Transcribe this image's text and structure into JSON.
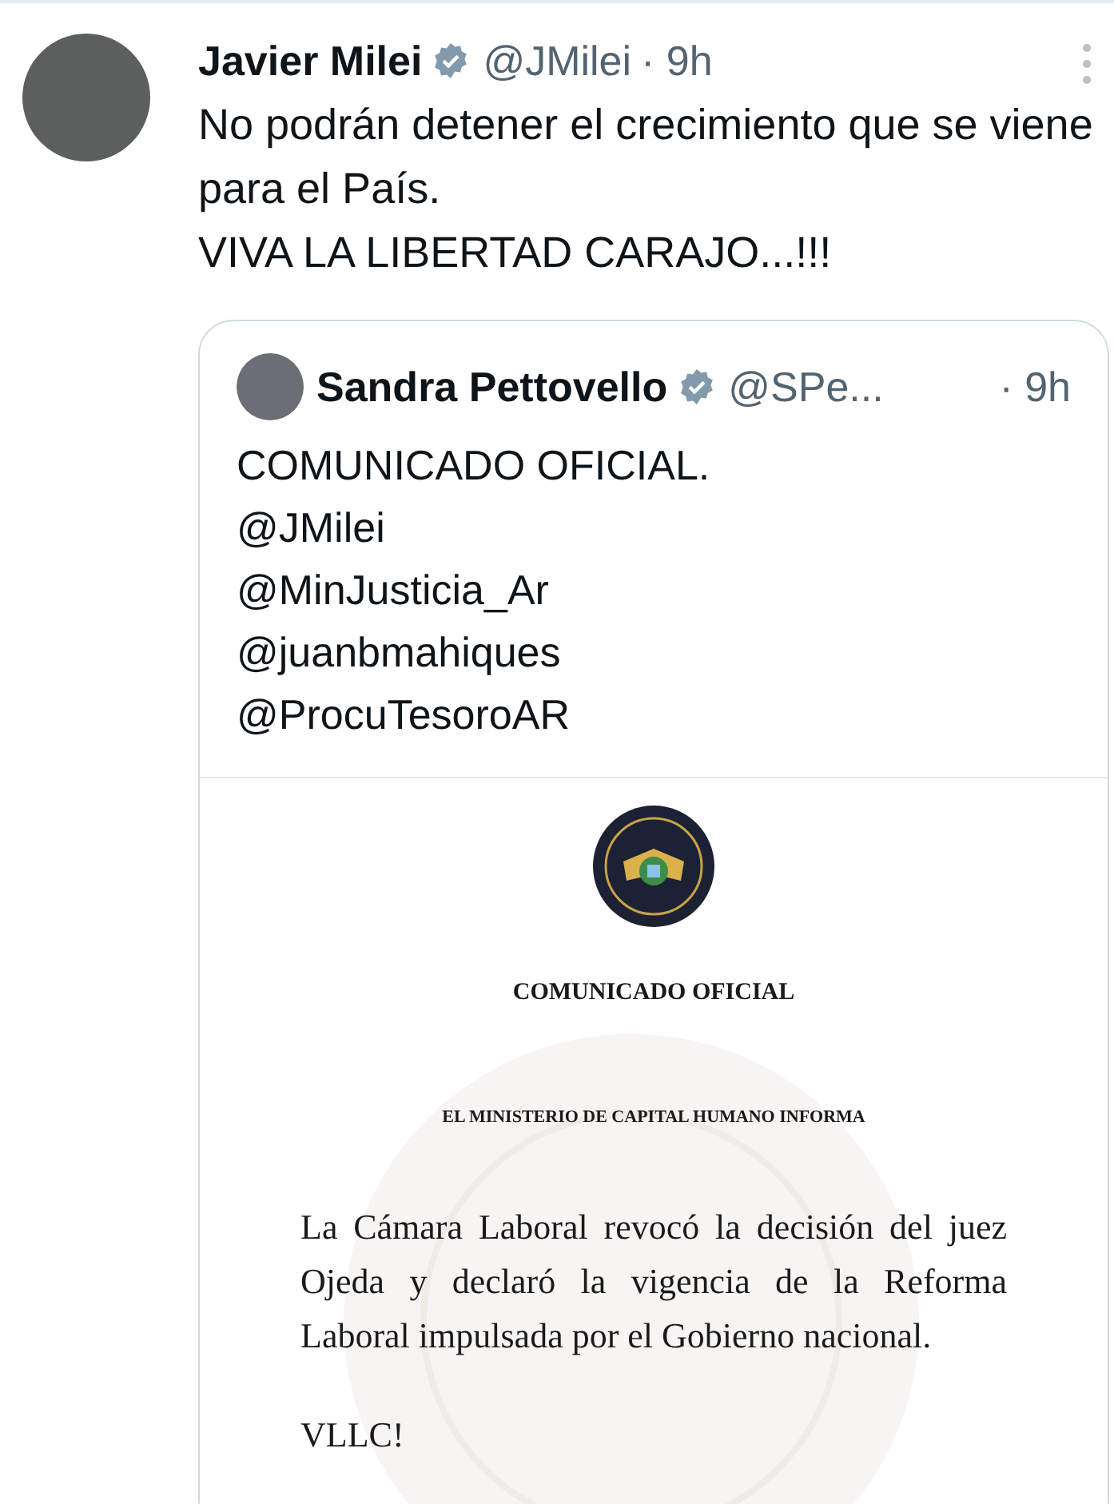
{
  "tweet": {
    "author_name": "Javier Milei",
    "verified": true,
    "handle": "@JMilei",
    "time": "· 9h",
    "lines": [
      "No podrán detener el crecimiento que se viene para el País.",
      "VIVA LA LIBERTAD CARAJO...!!!"
    ]
  },
  "quoted_tweet": {
    "author_name": "Sandra Pettovello",
    "verified": true,
    "handle": "@SPe...",
    "time": "· 9h",
    "lines": [
      "COMUNICADO OFICIAL.",
      "@JMilei",
      "@MinJusticia_Ar",
      "@juanbmahiques",
      "@ProcuTesoroAR"
    ],
    "document": {
      "title": "COMUNICADO OFICIAL",
      "subtitle": "EL MINISTERIO DE CAPITAL HUMANO INFORMA",
      "body": "La Cámara Laboral revocó la decisión del juez Ojeda y declaró la vigencia de la Reforma Laboral impulsada por el Gobierno nacional.",
      "closing": "VLLC!"
    }
  }
}
